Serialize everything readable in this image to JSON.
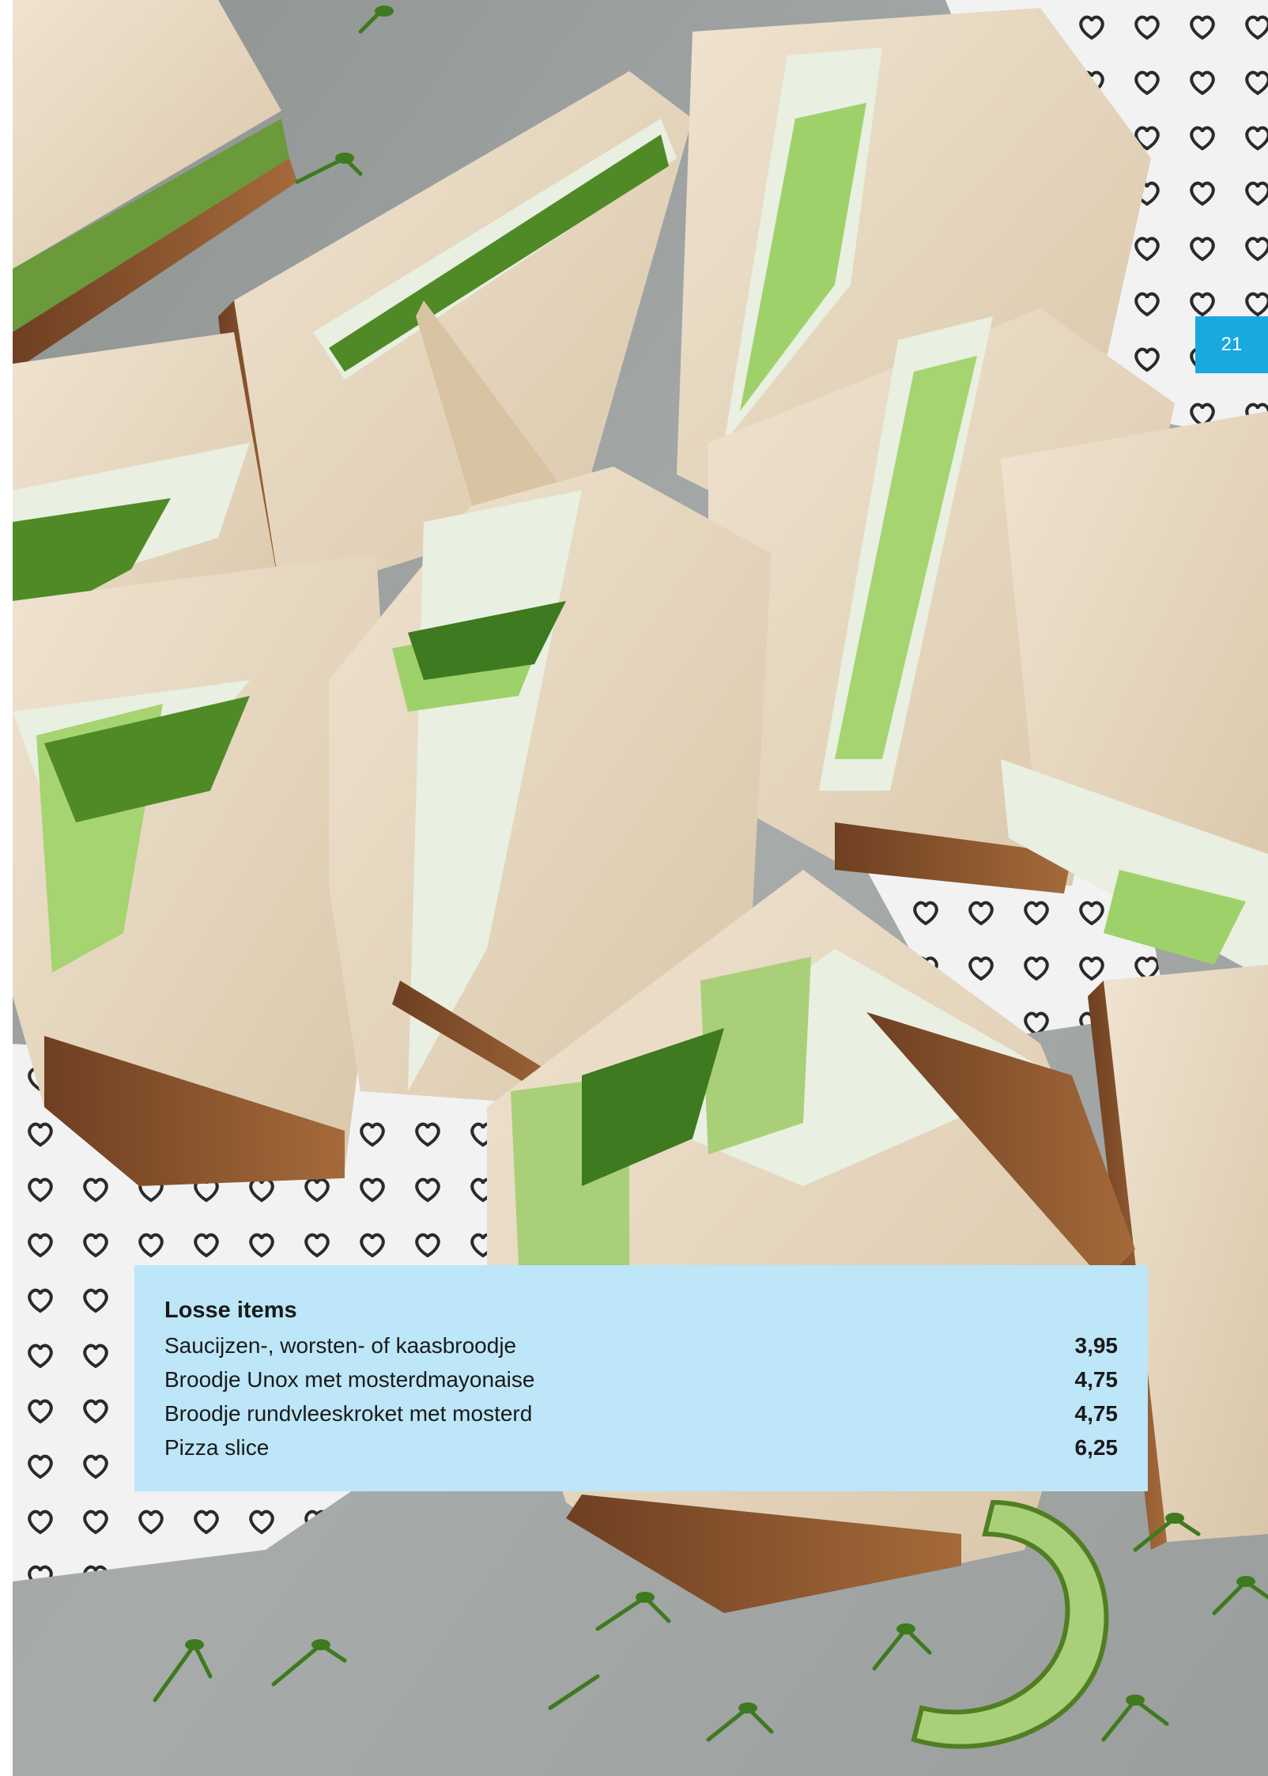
{
  "page": {
    "number": "21"
  },
  "price_panel": {
    "title": "Losse items",
    "items": [
      {
        "name": "Saucijzen-, worsten- of kaasbroodje",
        "price": "3,95"
      },
      {
        "name": "Broodje Unox met mosterdmayonaise",
        "price": "4,75"
      },
      {
        "name": "Broodje rundvleeskroket met mosterd",
        "price": "4,75"
      },
      {
        "name": "Pizza slice",
        "price": "6,25"
      }
    ]
  },
  "colors": {
    "accent": "#1aa8e0",
    "panel_background": "#bde6f8",
    "text": "#1a1a1a",
    "countertop": "#9fa3a2",
    "bread_crumb": "#e6d8c3",
    "bread_crust": "#8a5530",
    "cucumber": "#a9cf78",
    "cress": "#3e7a1f",
    "wrapping_paper": "#f2f2f2"
  },
  "icons": {
    "paper_pattern": "heart-logo-icon"
  }
}
